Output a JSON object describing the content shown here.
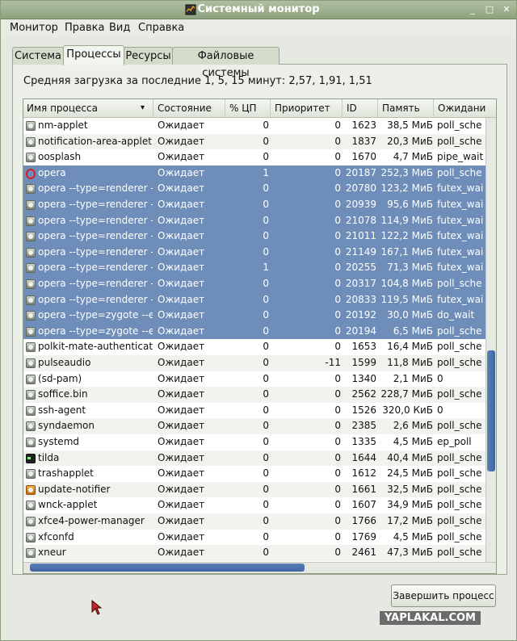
{
  "window": {
    "title": "Системный монитор"
  },
  "menu": [
    "Монитор",
    "Правка",
    "Вид",
    "Справка"
  ],
  "tabs": [
    {
      "label": "Система",
      "active": false
    },
    {
      "label": "Процессы",
      "active": true
    },
    {
      "label": "Ресурсы",
      "active": false
    },
    {
      "label": "Файловые системы",
      "active": false
    }
  ],
  "load_average": "Средняя загрузка за последние 1, 5, 15 минут: 2,57, 1,91, 1,51",
  "columns": [
    "Имя процесса",
    "Состояние",
    "% ЦП",
    "Приоритет",
    "ID",
    "Память",
    "Ожидани"
  ],
  "rows": [
    {
      "icon": "generic-icon",
      "name": "nm-applet",
      "state": "Ожидает",
      "cpu": "0",
      "prio": "0",
      "id": "1623",
      "mem": "38,5 МиБ",
      "wait": "poll_sche",
      "selected": false
    },
    {
      "icon": "generic-icon",
      "name": "notification-area-applet",
      "state": "Ожидает",
      "cpu": "0",
      "prio": "0",
      "id": "1837",
      "mem": "20,3 МиБ",
      "wait": "poll_sche",
      "selected": false
    },
    {
      "icon": "generic-icon",
      "name": "oosplash",
      "state": "Ожидает",
      "cpu": "0",
      "prio": "0",
      "id": "1670",
      "mem": "4,7 МиБ",
      "wait": "pipe_wait",
      "selected": false
    },
    {
      "icon": "opera-icon",
      "name": "opera",
      "state": "Ожидает",
      "cpu": "1",
      "prio": "0",
      "id": "20187",
      "mem": "252,3 МиБ",
      "wait": "poll_sche",
      "selected": true
    },
    {
      "icon": "generic-icon",
      "name": "opera --type=renderer --",
      "state": "Ожидает",
      "cpu": "0",
      "prio": "0",
      "id": "20780",
      "mem": "123,2 МиБ",
      "wait": "futex_wai",
      "selected": true
    },
    {
      "icon": "generic-icon",
      "name": "opera --type=renderer --",
      "state": "Ожидает",
      "cpu": "0",
      "prio": "0",
      "id": "20939",
      "mem": "95,6 МиБ",
      "wait": "futex_wai",
      "selected": true
    },
    {
      "icon": "generic-icon",
      "name": "opera --type=renderer --",
      "state": "Ожидает",
      "cpu": "0",
      "prio": "0",
      "id": "21078",
      "mem": "114,9 МиБ",
      "wait": "futex_wai",
      "selected": true
    },
    {
      "icon": "generic-icon",
      "name": "opera --type=renderer --",
      "state": "Ожидает",
      "cpu": "0",
      "prio": "0",
      "id": "21011",
      "mem": "122,2 МиБ",
      "wait": "futex_wai",
      "selected": true
    },
    {
      "icon": "generic-icon",
      "name": "opera --type=renderer --",
      "state": "Ожидает",
      "cpu": "0",
      "prio": "0",
      "id": "21149",
      "mem": "167,1 МиБ",
      "wait": "futex_wai",
      "selected": true
    },
    {
      "icon": "generic-icon",
      "name": "opera --type=renderer --",
      "state": "Ожидает",
      "cpu": "1",
      "prio": "0",
      "id": "20255",
      "mem": "71,3 МиБ",
      "wait": "futex_wai",
      "selected": true
    },
    {
      "icon": "generic-icon",
      "name": "opera --type=renderer --",
      "state": "Ожидает",
      "cpu": "0",
      "prio": "0",
      "id": "20317",
      "mem": "104,8 МиБ",
      "wait": "poll_sche",
      "selected": true
    },
    {
      "icon": "generic-icon",
      "name": "opera --type=renderer --",
      "state": "Ожидает",
      "cpu": "0",
      "prio": "0",
      "id": "20833",
      "mem": "119,5 МиБ",
      "wait": "futex_wai",
      "selected": true
    },
    {
      "icon": "generic-icon",
      "name": "opera --type=zygote --en",
      "state": "Ожидает",
      "cpu": "0",
      "prio": "0",
      "id": "20192",
      "mem": "30,0 МиБ",
      "wait": "do_wait",
      "selected": true
    },
    {
      "icon": "generic-icon",
      "name": "opera --type=zygote --en",
      "state": "Ожидает",
      "cpu": "0",
      "prio": "0",
      "id": "20194",
      "mem": "6,5 МиБ",
      "wait": "poll_sche",
      "selected": true
    },
    {
      "icon": "generic-icon",
      "name": "polkit-mate-authenticatio",
      "state": "Ожидает",
      "cpu": "0",
      "prio": "0",
      "id": "1653",
      "mem": "16,4 МиБ",
      "wait": "poll_sche",
      "selected": false
    },
    {
      "icon": "generic-icon",
      "name": "pulseaudio",
      "state": "Ожидает",
      "cpu": "0",
      "prio": "-11",
      "id": "1599",
      "mem": "11,8 МиБ",
      "wait": "poll_sche",
      "selected": false
    },
    {
      "icon": "generic-icon",
      "name": "(sd-pam)",
      "state": "Ожидает",
      "cpu": "0",
      "prio": "0",
      "id": "1340",
      "mem": "2,1 МиБ",
      "wait": "0",
      "selected": false
    },
    {
      "icon": "generic-icon",
      "name": "soffice.bin",
      "state": "Ожидает",
      "cpu": "0",
      "prio": "0",
      "id": "2562",
      "mem": "228,7 МиБ",
      "wait": "poll_sche",
      "selected": false
    },
    {
      "icon": "generic-icon",
      "name": "ssh-agent",
      "state": "Ожидает",
      "cpu": "0",
      "prio": "0",
      "id": "1526",
      "mem": "320,0 КиБ",
      "wait": "0",
      "selected": false
    },
    {
      "icon": "generic-icon",
      "name": "syndaemon",
      "state": "Ожидает",
      "cpu": "0",
      "prio": "0",
      "id": "2385",
      "mem": "2,6 МиБ",
      "wait": "poll_sche",
      "selected": false
    },
    {
      "icon": "generic-icon",
      "name": "systemd",
      "state": "Ожидает",
      "cpu": "0",
      "prio": "0",
      "id": "1335",
      "mem": "4,5 МиБ",
      "wait": "ep_poll",
      "selected": false
    },
    {
      "icon": "tilda-icon",
      "name": "tilda",
      "state": "Ожидает",
      "cpu": "0",
      "prio": "0",
      "id": "1644",
      "mem": "40,4 МиБ",
      "wait": "poll_sche",
      "selected": false
    },
    {
      "icon": "generic-icon",
      "name": "trashapplet",
      "state": "Ожидает",
      "cpu": "0",
      "prio": "0",
      "id": "1612",
      "mem": "24,5 МиБ",
      "wait": "poll_sche",
      "selected": false
    },
    {
      "icon": "update-icon",
      "name": "update-notifier",
      "state": "Ожидает",
      "cpu": "0",
      "prio": "0",
      "id": "1661",
      "mem": "32,5 МиБ",
      "wait": "poll_sche",
      "selected": false
    },
    {
      "icon": "generic-icon",
      "name": "wnck-applet",
      "state": "Ожидает",
      "cpu": "0",
      "prio": "0",
      "id": "1607",
      "mem": "34,9 МиБ",
      "wait": "poll_sche",
      "selected": false
    },
    {
      "icon": "generic-icon",
      "name": "xfce4-power-manager",
      "state": "Ожидает",
      "cpu": "0",
      "prio": "0",
      "id": "1766",
      "mem": "17,2 МиБ",
      "wait": "poll_sche",
      "selected": false
    },
    {
      "icon": "generic-icon",
      "name": "xfconfd",
      "state": "Ожидает",
      "cpu": "0",
      "prio": "0",
      "id": "1769",
      "mem": "4,5 МиБ",
      "wait": "poll_sche",
      "selected": false
    },
    {
      "icon": "generic-icon",
      "name": "xneur",
      "state": "Ожидает",
      "cpu": "0",
      "prio": "0",
      "id": "2461",
      "mem": "47,3 МиБ",
      "wait": "poll_sche",
      "selected": false
    }
  ],
  "vertical_scroll_fraction": 0.72,
  "horizontal_scroll_fraction": 0.0,
  "end_process_button": "Завершить процесс",
  "watermark": "YAPLAKAL.COM",
  "colors": {
    "selection": "#6f8db9",
    "titlebar": "#9fb090",
    "scrollbar": "#4a6dab"
  }
}
